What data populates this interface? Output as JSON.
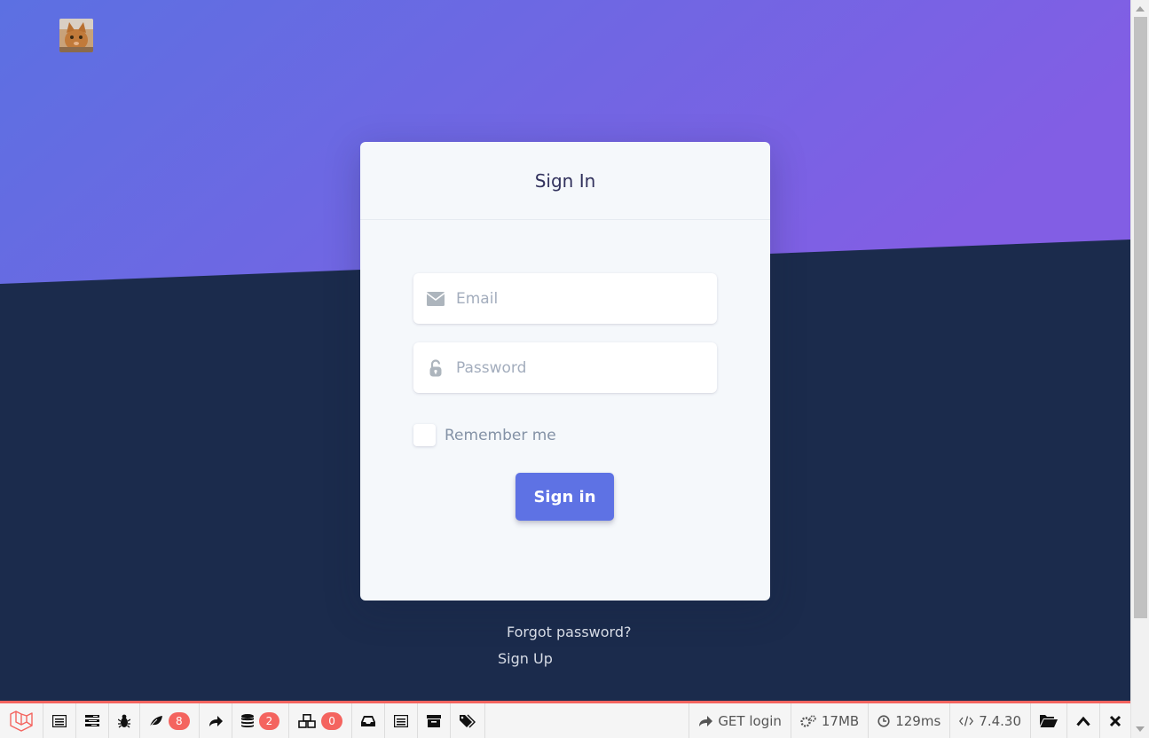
{
  "card": {
    "title": "Sign In",
    "email_placeholder": "Email",
    "password_placeholder": "Password",
    "remember_label": "Remember me",
    "signin_label": "Sign in"
  },
  "links": {
    "forgot": "Forgot password?",
    "signup": "Sign Up"
  },
  "debugbar": {
    "events_count": "8",
    "queries_count": "2",
    "models_count": "0",
    "route": "GET login",
    "memory": "17MB",
    "time": "129ms",
    "php_version": "7.4.30"
  },
  "colors": {
    "gradient_start": "#5e72e4",
    "gradient_end": "#825ee4",
    "background": "#1b2b4c",
    "accent": "#5e72e4",
    "badge": "#f4645f"
  },
  "icons": {
    "logo": "cat-photo-logo",
    "email": "envelope-icon",
    "password": "unlock-icon"
  }
}
